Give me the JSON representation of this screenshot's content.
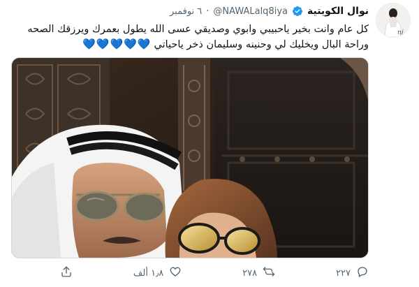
{
  "tweet": {
    "display_name": "نوال الكويتية",
    "handle": "@NAWALalq8iya",
    "separator": "·",
    "date": "٦ نوفمبر",
    "text_line1": "كل عام وانت بخير ياحبيبي وابوي وصديقي عسى الله يطول بعمرك ويرزقك الصحه",
    "text_line2": "وراحة البال ويخليك لي وحنينه وسليمان ذخر ياحياتي",
    "hearts": "💙💙💙💙💙",
    "verified_icon": "verified-badge-icon",
    "accent_color": "#1d9bf0",
    "heart_color": "#5dadec"
  },
  "actions": {
    "reply_count": "٢٢٧",
    "retweet_count": "٢٧٨",
    "like_count": "١٫٨ ألف",
    "icons": [
      "reply-icon",
      "retweet-icon",
      "like-icon",
      "share-icon"
    ]
  }
}
